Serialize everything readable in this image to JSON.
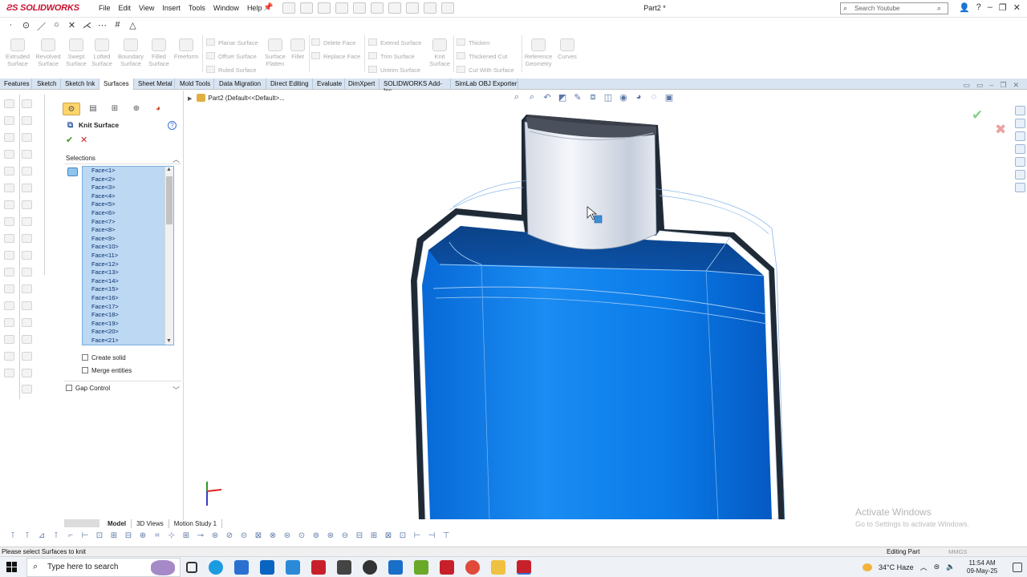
{
  "app": {
    "brand": "SOLIDWORKS",
    "doc_title": "Part2 *"
  },
  "menu": [
    "File",
    "Edit",
    "View",
    "Insert",
    "Tools",
    "Window",
    "Help"
  ],
  "search": {
    "placeholder": "Search Youtube"
  },
  "ribbon": {
    "big": [
      {
        "key": "extruded",
        "label": "Extruded Surface"
      },
      {
        "key": "revolved",
        "label": "Revolved Surface"
      },
      {
        "key": "swept",
        "label": "Swept Surface"
      },
      {
        "key": "lofted",
        "label": "Lofted Surface"
      },
      {
        "key": "boundary",
        "label": "Boundary Surface"
      },
      {
        "key": "filled",
        "label": "Filled Surface"
      },
      {
        "key": "freeform",
        "label": "Freeform"
      },
      {
        "key": "flatten",
        "label": "Surface Flatten"
      },
      {
        "key": "fillet",
        "label": "Fillet"
      },
      {
        "key": "knit",
        "label": "Knit Surface"
      },
      {
        "key": "refgeom",
        "label": "Reference Geometry"
      },
      {
        "key": "curves",
        "label": "Curves"
      }
    ],
    "small": {
      "planar": "Planar Surface",
      "offset": "Offset Surface",
      "ruled": "Ruled Surface",
      "delete_face": "Delete Face",
      "replace_face": "Replace Face",
      "extend": "Extend Surface",
      "trim": "Trim Surface",
      "untrim": "Untrim Surface",
      "thicken": "Thicken",
      "thickened_cut": "Thickened Cut",
      "cut_with_surface": "Cut With Surface"
    }
  },
  "tabs": [
    "Features",
    "Sketch",
    "Sketch Ink",
    "Surfaces",
    "Sheet Metal",
    "Mold Tools",
    "Data Migration",
    "Direct Editing",
    "Evaluate",
    "DimXpert",
    "SOLIDWORKS Add-Ins",
    "SimLab OBJ Exporter"
  ],
  "active_tab": "Surfaces",
  "feature_tree": {
    "label": "Part2  (Default<<Default>..."
  },
  "property_manager": {
    "title": "Knit Surface",
    "selections_header": "Selections",
    "faces": [
      "Face<1>",
      "Face<2>",
      "Face<3>",
      "Face<4>",
      "Face<5>",
      "Face<6>",
      "Face<7>",
      "Face<8>",
      "Face<9>",
      "Face<10>",
      "Face<11>",
      "Face<12>",
      "Face<13>",
      "Face<14>",
      "Face<15>",
      "Face<16>",
      "Face<17>",
      "Face<18>",
      "Face<19>",
      "Face<20>",
      "Face<21>"
    ],
    "create_solid": {
      "label": "Create solid",
      "checked": false
    },
    "merge_entities": {
      "label": "Merge entities",
      "checked": false
    },
    "gap_control": {
      "label": "Gap Control",
      "checked": false
    }
  },
  "bottom_tabs": [
    "Model",
    "3D Views",
    "Motion Study 1"
  ],
  "active_bottom_tab": "Model",
  "watermark": {
    "line1": "Activate Windows",
    "line2": "Go to Settings to activate Windows."
  },
  "status": {
    "message": "Please select Surfaces to knit",
    "mode": "Editing Part",
    "units": "MMGS"
  },
  "taskbar": {
    "search_placeholder": "Type here to search",
    "weather": "34°C  Haze",
    "time": "11:54 AM",
    "date": "09-May-25"
  },
  "colors": {
    "selection_blue": "#bcd8f3",
    "model_blue": "#0a7be8",
    "tab_strip": "#d8e4f2"
  }
}
